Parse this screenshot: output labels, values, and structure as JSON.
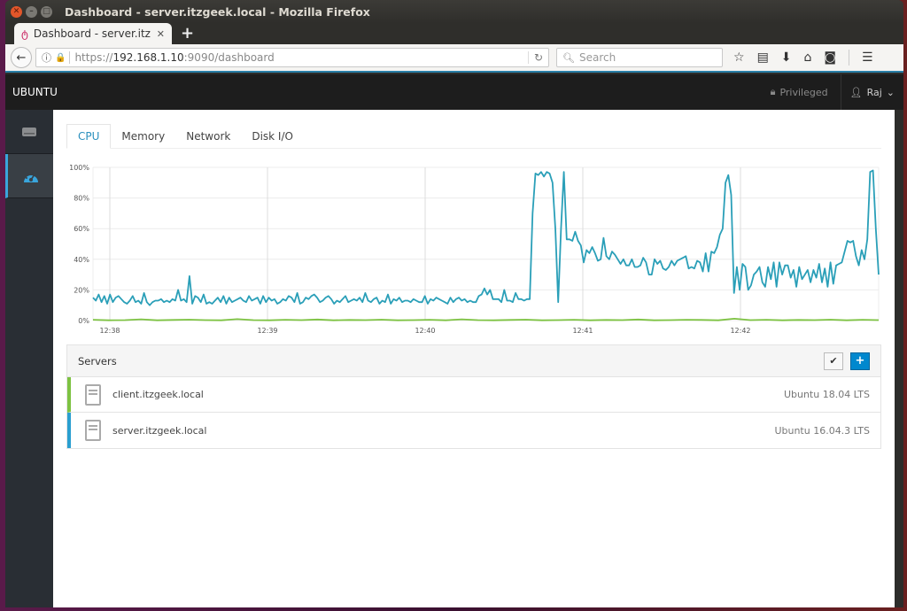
{
  "window": {
    "title": "Dashboard - server.itzgeek.local - Mozilla Firefox"
  },
  "browser": {
    "tab_title": "Dashboard - server.itz",
    "url_prefix": "https://",
    "url_host": "192.168.1.10",
    "url_rest": ":9090/dashboard",
    "search_placeholder": "Search",
    "new_tab": "+",
    "tab_close": "✕"
  },
  "app": {
    "brand": "UBUNTU",
    "privileged_label": "Privileged",
    "user_label": "Raj",
    "accent_color": "#39a5dc"
  },
  "tabs": [
    {
      "label": "CPU",
      "active": true
    },
    {
      "label": "Memory",
      "active": false
    },
    {
      "label": "Network",
      "active": false
    },
    {
      "label": "Disk I/O",
      "active": false
    }
  ],
  "servers": {
    "title": "Servers",
    "rows": [
      {
        "name": "client.itzgeek.local",
        "os": "Ubuntu 18.04 LTS",
        "color": "#7dc242"
      },
      {
        "name": "server.itzgeek.local",
        "os": "Ubuntu 16.04.3 LTS",
        "color": "#2a9fd0"
      }
    ]
  },
  "chart_data": {
    "type": "line",
    "title": "CPU",
    "xlabel": "",
    "ylabel": "",
    "ylim": [
      0,
      100
    ],
    "yticks": [
      "0%",
      "20%",
      "40%",
      "60%",
      "80%",
      "100%"
    ],
    "xticks": [
      "12:38",
      "12:39",
      "12:40",
      "12:41",
      "12:42"
    ],
    "grid": true,
    "series": [
      {
        "name": "server.itzgeek.local",
        "color": "#2a9fb8",
        "values": [
          15,
          13,
          17,
          12,
          16,
          11,
          17,
          12,
          15,
          16,
          14,
          12,
          11,
          13,
          16,
          12,
          13,
          11,
          18,
          12,
          10,
          12,
          13,
          13,
          14,
          12,
          13,
          12,
          14,
          13,
          20,
          13,
          14,
          12,
          29,
          11,
          16,
          15,
          12,
          17,
          11,
          12,
          11,
          13,
          15,
          12,
          16,
          11,
          15,
          12,
          13,
          14,
          15,
          13,
          12,
          16,
          13,
          14,
          15,
          11,
          16,
          12,
          15,
          13,
          14,
          11,
          12,
          14,
          13,
          16,
          15,
          12,
          18,
          11,
          12,
          15,
          14,
          16,
          17,
          15,
          12,
          13,
          15,
          16,
          14,
          11,
          13,
          12,
          14,
          16,
          12,
          13,
          14,
          13,
          15,
          12,
          18,
          13,
          12,
          14,
          15,
          11,
          13,
          12,
          17,
          11,
          14,
          13,
          15,
          12,
          13,
          13,
          12,
          14,
          13,
          12,
          12,
          16,
          11,
          14,
          13,
          15,
          14,
          13,
          12,
          11,
          15,
          12,
          14,
          15,
          13,
          14,
          12,
          13,
          12,
          12,
          16,
          17,
          21,
          17,
          20,
          14,
          14,
          14,
          12,
          20,
          13,
          13,
          12,
          18,
          14,
          14,
          13,
          14,
          14,
          70,
          96,
          95,
          97,
          94,
          97,
          96,
          90,
          60,
          12,
          60,
          97,
          53,
          53,
          52,
          58,
          52,
          49,
          38,
          46,
          44,
          48,
          44,
          39,
          40,
          54,
          42,
          40,
          45,
          43,
          40,
          37,
          40,
          36,
          36,
          40,
          35,
          35,
          36,
          41,
          38,
          30,
          30,
          40,
          37,
          39,
          34,
          33,
          35,
          39,
          36,
          39,
          40,
          41,
          42,
          34,
          35,
          34,
          39,
          38,
          32,
          44,
          32,
          45,
          44,
          48,
          56,
          60,
          90,
          95,
          82,
          18,
          35,
          20,
          37,
          35,
          20,
          23,
          30,
          32,
          35,
          25,
          22,
          35,
          27,
          38,
          22,
          38,
          30,
          36,
          36,
          28,
          33,
          22,
          35,
          27,
          30,
          33,
          25,
          33,
          28,
          37,
          25,
          34,
          22,
          38,
          24,
          36,
          37,
          38,
          45,
          52,
          51,
          52,
          42,
          36,
          46,
          40,
          53,
          97,
          98,
          60,
          30
        ],
        "note": "approximate trace read from chart"
      },
      {
        "name": "client.itzgeek.local",
        "color": "#7dc242",
        "values_summary": "near 0% throughout (0–1%)",
        "values": [
          0.5,
          0.2,
          0.3,
          0.8,
          0.2,
          0.4,
          0.6,
          0.3,
          0.2,
          0.9,
          0.3,
          0.2,
          0.5,
          0.3,
          0.7,
          0.2,
          0.4,
          0.3,
          0.6,
          0.2,
          0.3,
          0.5,
          0.2,
          0.8,
          0.3,
          0.2,
          0.4,
          0.6,
          0.2,
          0.3,
          0.5,
          0.2,
          0.4,
          0.3,
          0.7,
          0.2,
          0.3,
          0.5,
          0.4,
          0.2,
          1.2,
          0.3,
          0.5,
          0.2,
          0.4,
          0.3,
          0.6,
          0.2,
          0.5,
          0.3
        ]
      }
    ]
  }
}
